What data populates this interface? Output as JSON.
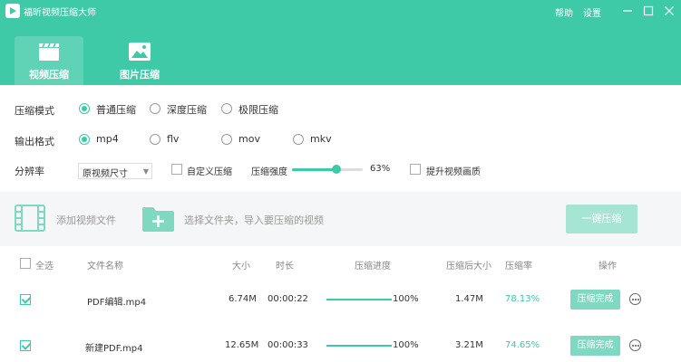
{
  "app": {
    "title": "福昕视频压缩大师",
    "help": "帮助",
    "settings": "设置",
    "colors": {
      "accent": "#3ec9a7"
    }
  },
  "tabs": [
    {
      "label": "视频压缩",
      "icon": "video-clapper-icon",
      "active": true
    },
    {
      "label": "图片压缩",
      "icon": "image-icon",
      "active": false
    }
  ],
  "options": {
    "mode": {
      "label": "压缩模式",
      "choices": [
        "普通压缩",
        "深度压缩",
        "极限压缩"
      ],
      "selected": 0
    },
    "format": {
      "label": "输出格式",
      "choices": [
        "mp4",
        "flv",
        "mov",
        "mkv"
      ],
      "selected": 0
    },
    "resolution": {
      "label": "分辨率",
      "value": "原视频尺寸",
      "custom_label": "自定义压缩",
      "strength_label": "压缩强度",
      "strength_value": "63%",
      "strength": 63,
      "enhance_label": "提升视频画质"
    }
  },
  "actions": {
    "add_file": "添加视频文件",
    "add_folder": "选择文件夹，导入要压缩的视频",
    "compress_all": "一键压缩"
  },
  "table": {
    "headers": {
      "select_all": "全选",
      "name": "文件名称",
      "size": "大小",
      "duration": "时长",
      "progress": "压缩进度",
      "new_size": "压缩后大小",
      "rate": "压缩率",
      "op": "操作"
    },
    "rows": [
      {
        "name": "PDF编辑.mp4",
        "size": "6.74M",
        "duration": "00:00:22",
        "progress": "100%",
        "progress_value": 100,
        "new_size": "1.47M",
        "rate": "78.13%",
        "status": "压缩完成"
      },
      {
        "name": "新建PDF.mp4",
        "size": "12.65M",
        "duration": "00:00:33",
        "progress": "100%",
        "progress_value": 100,
        "new_size": "3.21M",
        "rate": "74.65%",
        "status": "压缩完成"
      }
    ]
  }
}
